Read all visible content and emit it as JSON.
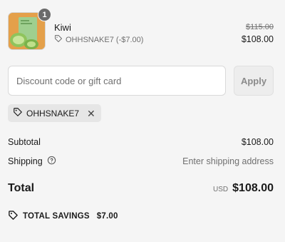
{
  "product": {
    "name": "Kiwi",
    "quantity": "1",
    "discount_line": "OHHSNAKE7 (-$7.00)",
    "original_price": "$115.00",
    "price": "$108.00"
  },
  "discount": {
    "placeholder": "Discount code or gift card",
    "apply_label": "Apply"
  },
  "applied_code": {
    "code": "OHHSNAKE7",
    "remove_glyph": "✕"
  },
  "summary": {
    "subtotal_label": "Subtotal",
    "subtotal_value": "$108.00",
    "shipping_label": "Shipping",
    "shipping_value": "Enter shipping address",
    "total_label": "Total",
    "currency": "USD",
    "total_value": "$108.00",
    "savings_label": "TOTAL SAVINGS",
    "savings_value": "$7.00"
  },
  "icons": {
    "tag": "tag-icon",
    "help": "help-circle-icon",
    "close": "close-icon"
  }
}
